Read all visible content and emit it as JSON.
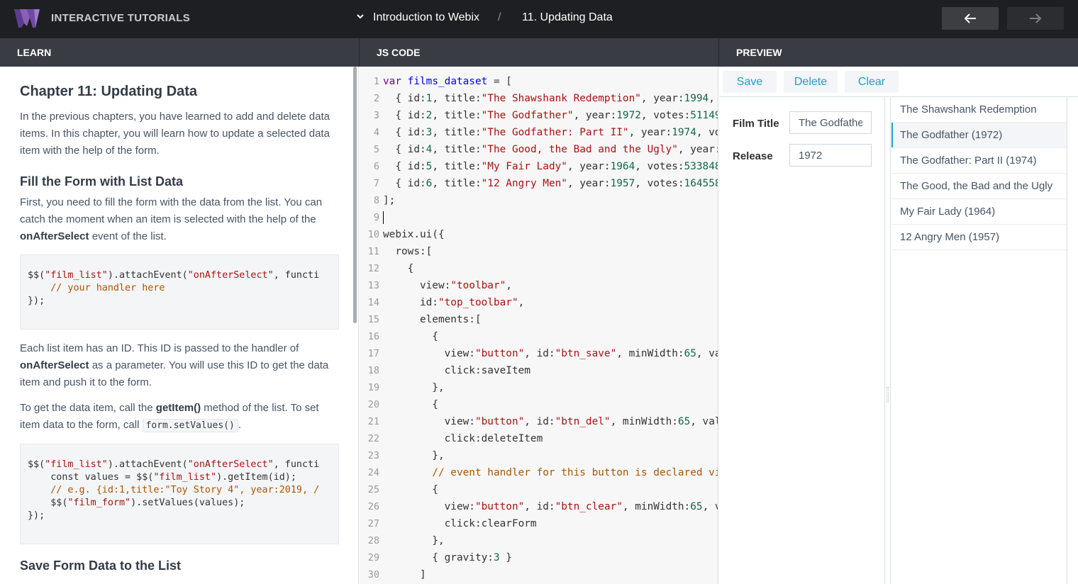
{
  "topbar": {
    "app_title": "INTERACTIVE TUTORIALS",
    "course": "Introduction to Webix",
    "separator": "/",
    "lesson": "11. Updating Data"
  },
  "panels": {
    "learn": "LEARN",
    "code": "JS CODE",
    "preview": "PREVIEW"
  },
  "learn": {
    "chapter_title": "Chapter 11: Updating Data",
    "intro": "In the previous chapters, you have learned to add and delete data items. In this chapter, you will learn how to update a selected data item with the help of the form.",
    "section1_title": "Fill the Form with List Data",
    "section1_text_a": "First, you need to fill the form with the data from the list. You can catch the moment when an item is selected with the help of the ",
    "section1_bold": "onAfterSelect",
    "section1_text_b": " event of the list.",
    "code1": "$$(\"film_list\").attachEvent(\"onAfterSelect\", functi\n    // your handler here\n});",
    "para2_a": "Each list item has an ID. This ID is passed to the handler of ",
    "para2_bold": "onAfterSelect",
    "para2_b": " as a parameter. You will use this ID to get the data item and push it to the form.",
    "para3_a": "To get the data item, call the ",
    "para3_bold": "getItem()",
    "para3_b": " method of the list. To set item data to the form, call ",
    "para3_code": "form.setValues()",
    "para3_c": ".",
    "code2": "$$(\"film_list\").attachEvent(\"onAfterSelect\", functi\n    const values = $$(\"film_list\").getItem(id);\n    // e.g. {id:1,title:\"Toy Story 4\", year:2019, /\n    $$(\"film_form\").setValues(values);\n});",
    "section2_title": "Save Form Data to the List"
  },
  "code_lines": [
    "1",
    "2",
    "3",
    "4",
    "5",
    "6",
    "7",
    "8",
    "9",
    "10",
    "11",
    "12",
    "13",
    "14",
    "15",
    "16",
    "17",
    "18",
    "19",
    "20",
    "21",
    "22",
    "23",
    "24",
    "25",
    "26",
    "27",
    "28",
    "29",
    "30"
  ],
  "code": {
    "l1_kw": "var",
    "l1_def": "films_dataset",
    "l1_rest": " = [",
    "l2": [
      "  { id:",
      "1",
      ", title:",
      "\"The Shawshank Redemption\"",
      ", year:",
      "1994",
      ","
    ],
    "l3": [
      "  { id:",
      "2",
      ", title:",
      "\"The Godfather\"",
      ", year:",
      "1972",
      ", votes:",
      "51149"
    ],
    "l4": [
      "  { id:",
      "3",
      ", title:",
      "\"The Godfather: Part II\"",
      ", year:",
      "1974",
      ", vo"
    ],
    "l5": [
      "  { id:",
      "4",
      ", title:",
      "\"The Good, the Bad and the Ugly\"",
      ", year:"
    ],
    "l6": [
      "  { id:",
      "5",
      ", title:",
      "\"My Fair Lady\"",
      ", year:",
      "1964",
      ", votes:",
      "533848"
    ],
    "l7": [
      "  { id:",
      "6",
      ", title:",
      "\"12 Angry Men\"",
      ", year:",
      "1957",
      ", votes:",
      "164558"
    ],
    "l8": "];",
    "l10": "webix.ui({",
    "l11": "  rows:[",
    "l12": "    {",
    "l13": [
      "      view:",
      "\"toolbar\"",
      ","
    ],
    "l14": [
      "      id:",
      "\"top_toolbar\"",
      ","
    ],
    "l15": "      elements:[",
    "l16": "        {",
    "l17": [
      "          view:",
      "\"button\"",
      ", id:",
      "\"btn_save\"",
      ", minWidth:",
      "65",
      ", va"
    ],
    "l18": "          click:saveItem",
    "l19": "        },",
    "l20": "        {",
    "l21": [
      "          view:",
      "\"button\"",
      ", id:",
      "\"btn_del\"",
      ", minWidth:",
      "65",
      ", val"
    ],
    "l22": "          click:deleteItem",
    "l23": "        },",
    "l24": "        // event handler for this button is declared vi",
    "l25": "        {",
    "l26": [
      "          view:",
      "\"button\"",
      ", id:",
      "\"btn_clear\"",
      ", minWidth:",
      "65",
      ", v"
    ],
    "l27": "          click:clearForm",
    "l28": "        },",
    "l29": [
      "        { gravity:",
      "3",
      " }"
    ],
    "l30": "      ]"
  },
  "preview": {
    "buttons": {
      "save": "Save",
      "delete": "Delete",
      "clear": "Clear"
    },
    "form": {
      "title_label": "Film Title",
      "title_value": "The Godfather",
      "release_label": "Release",
      "release_value": "1972"
    },
    "list": [
      "The Shawshank Redemption",
      "The Godfather (1972)",
      "The Godfather: Part II (1974)",
      "The Good, the Bad and the Ugly",
      "My Fair Lady (1964)",
      "12 Angry Men (1957)"
    ],
    "selected_index": 1
  },
  "colors": {
    "accent": "#1ca1c1",
    "topbar": "#1e1f22",
    "panel_header": "#393d43"
  }
}
